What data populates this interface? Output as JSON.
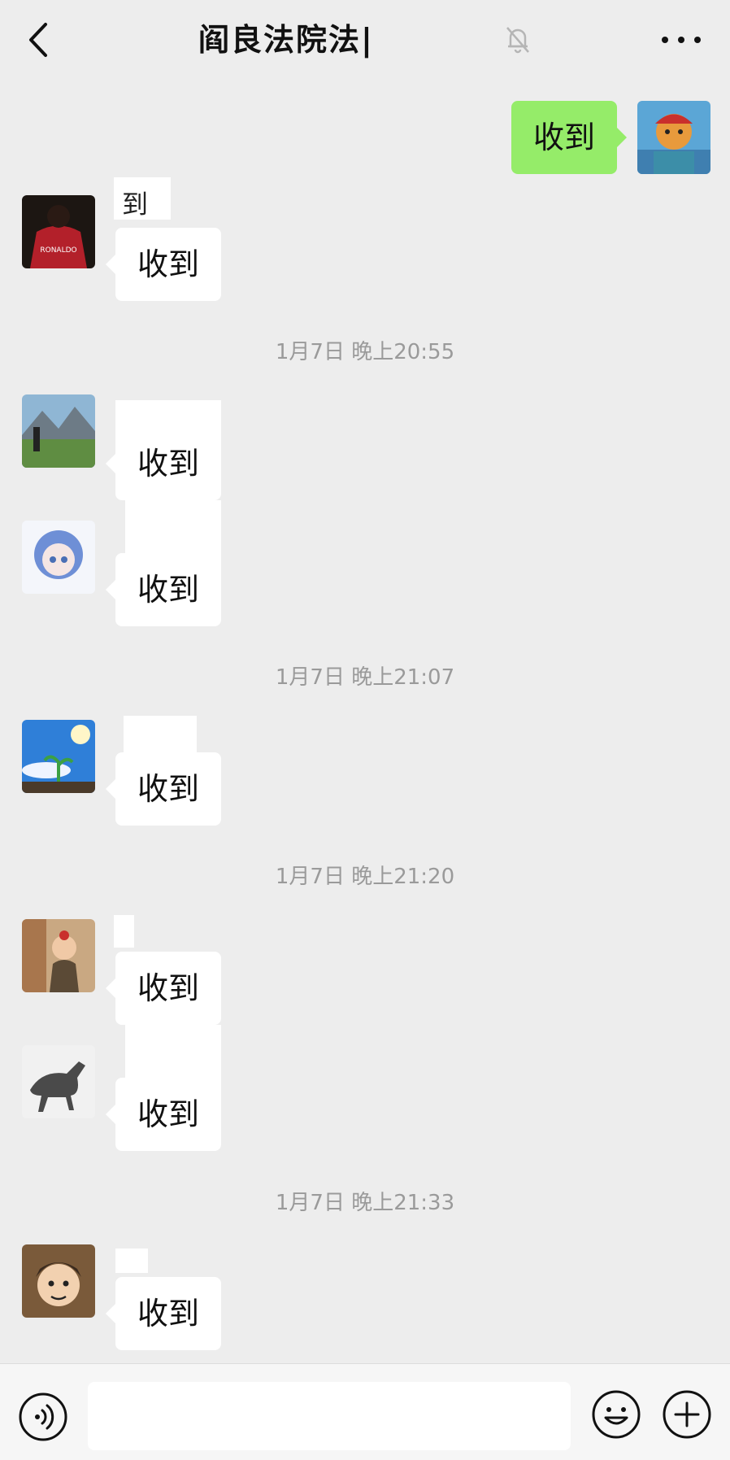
{
  "header": {
    "title": "阎良法院法|",
    "back_icon": "chevron-left-icon",
    "mute_icon": "bell-off-icon",
    "more_icon": "more-dots-icon"
  },
  "messages": {
    "sent_1": {
      "text": "收到"
    },
    "recv_1": {
      "sender_fragment": "到",
      "text": "收到"
    },
    "recv_2": {
      "text": "收到"
    },
    "recv_3": {
      "text": "收到"
    },
    "recv_4": {
      "text": "收到"
    },
    "recv_5": {
      "text": "收到"
    },
    "recv_6": {
      "text": "收到"
    },
    "recv_7": {
      "text": "收到"
    }
  },
  "timestamps": {
    "t1": "1月7日 晚上20:55",
    "t2": "1月7日 晚上21:07",
    "t3": "1月7日 晚上21:20",
    "t4": "1月7日 晚上21:33"
  },
  "input_bar": {
    "value": "",
    "voice_icon": "voice-icon",
    "emoji_icon": "emoji-icon",
    "plus_icon": "plus-icon"
  },
  "colors": {
    "background": "#ededed",
    "sent_bubble": "#95ec69",
    "received_bubble": "#ffffff",
    "timestamp": "#9a9a9a"
  }
}
